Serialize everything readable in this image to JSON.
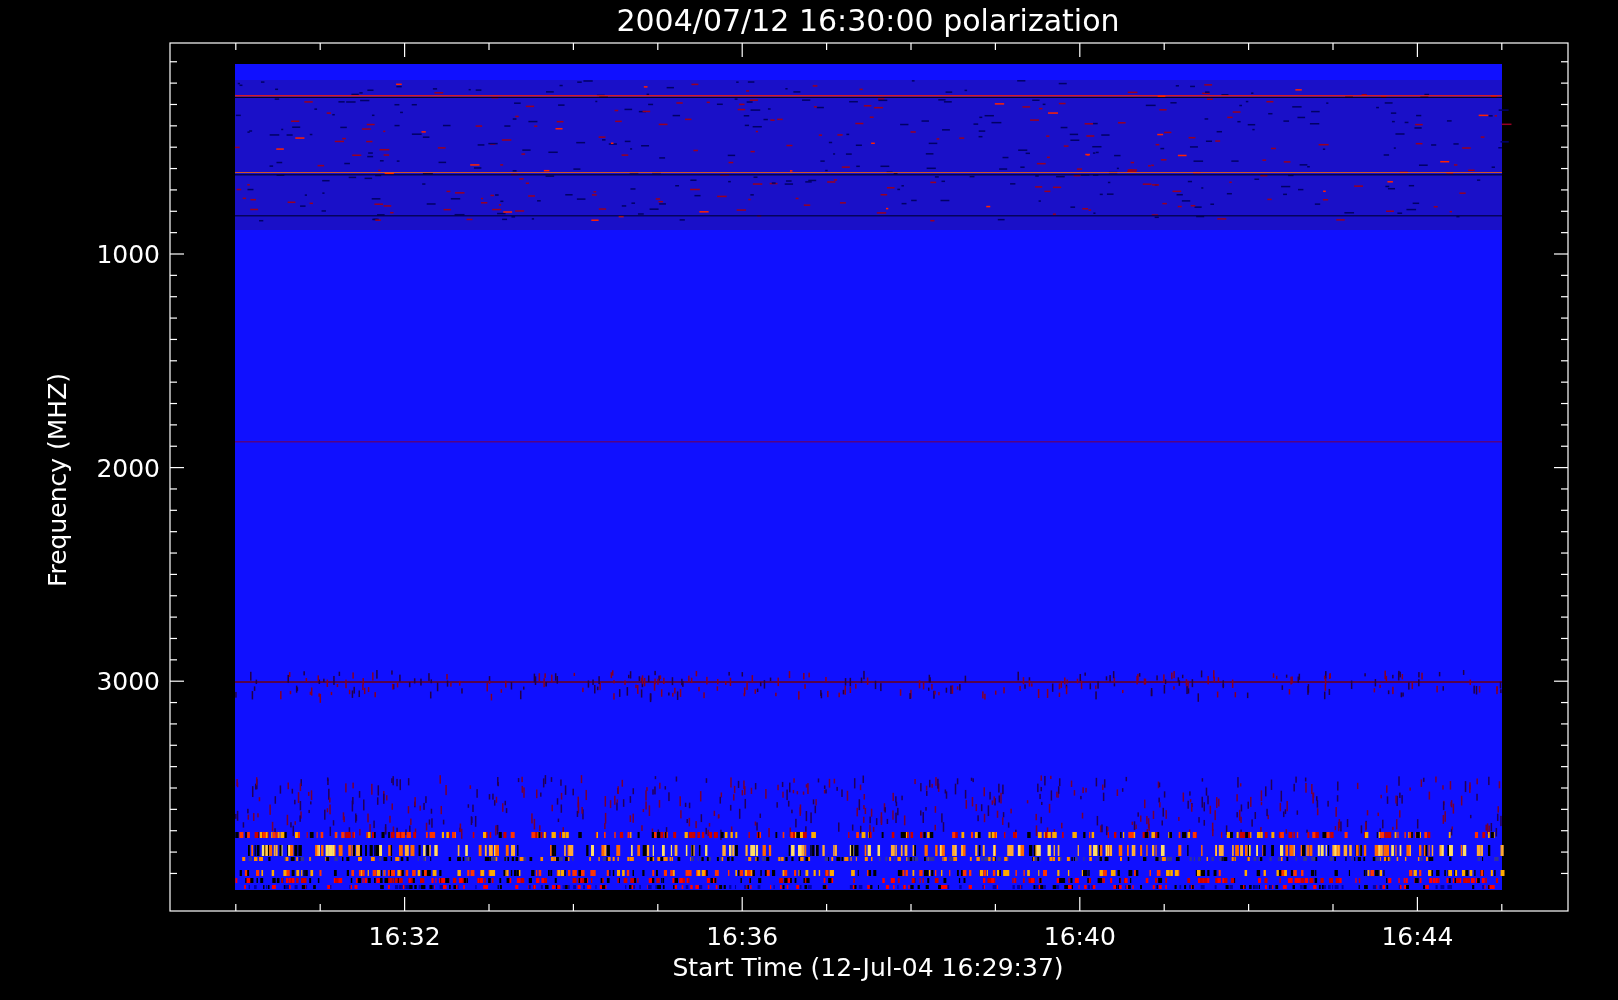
{
  "chart": {
    "title": "2004/07/12 16:30:00 polarization",
    "xlabel": "Start Time (12-Jul-04 16:29:37)",
    "ylabel": "Frequency (MHZ)",
    "xticks": [
      {
        "label": "16:32"
      },
      {
        "label": "16:36"
      },
      {
        "label": "16:40"
      },
      {
        "label": "16:44"
      }
    ],
    "yticks": [
      {
        "label": "1000"
      },
      {
        "label": "2000"
      },
      {
        "label": "3000"
      }
    ]
  }
}
